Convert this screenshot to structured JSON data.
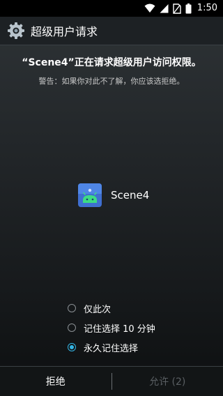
{
  "status_bar": {
    "time": "1:50",
    "icons": [
      "wifi-icon",
      "cell-signal-icon",
      "no-sim-icon",
      "battery-icon"
    ]
  },
  "action_bar": {
    "icon": "gear-icon",
    "title": "超级用户请求"
  },
  "request": {
    "title": "“Scene4”正在请求超级用户访问权限。",
    "warning": "警告：如果你对此不了解，你应该选拒绝。"
  },
  "app": {
    "name": "Scene4",
    "icon": "scene4-app-icon"
  },
  "options": [
    {
      "label": "仅此次",
      "checked": false
    },
    {
      "label": "记住选择 10 分钟",
      "checked": false
    },
    {
      "label": "永久记住选择",
      "checked": true
    }
  ],
  "buttons": {
    "deny": "拒绝",
    "allow": "允许 (2)"
  },
  "colors": {
    "accent": "#33b5e5",
    "disabled_text": "#5a5f63"
  }
}
